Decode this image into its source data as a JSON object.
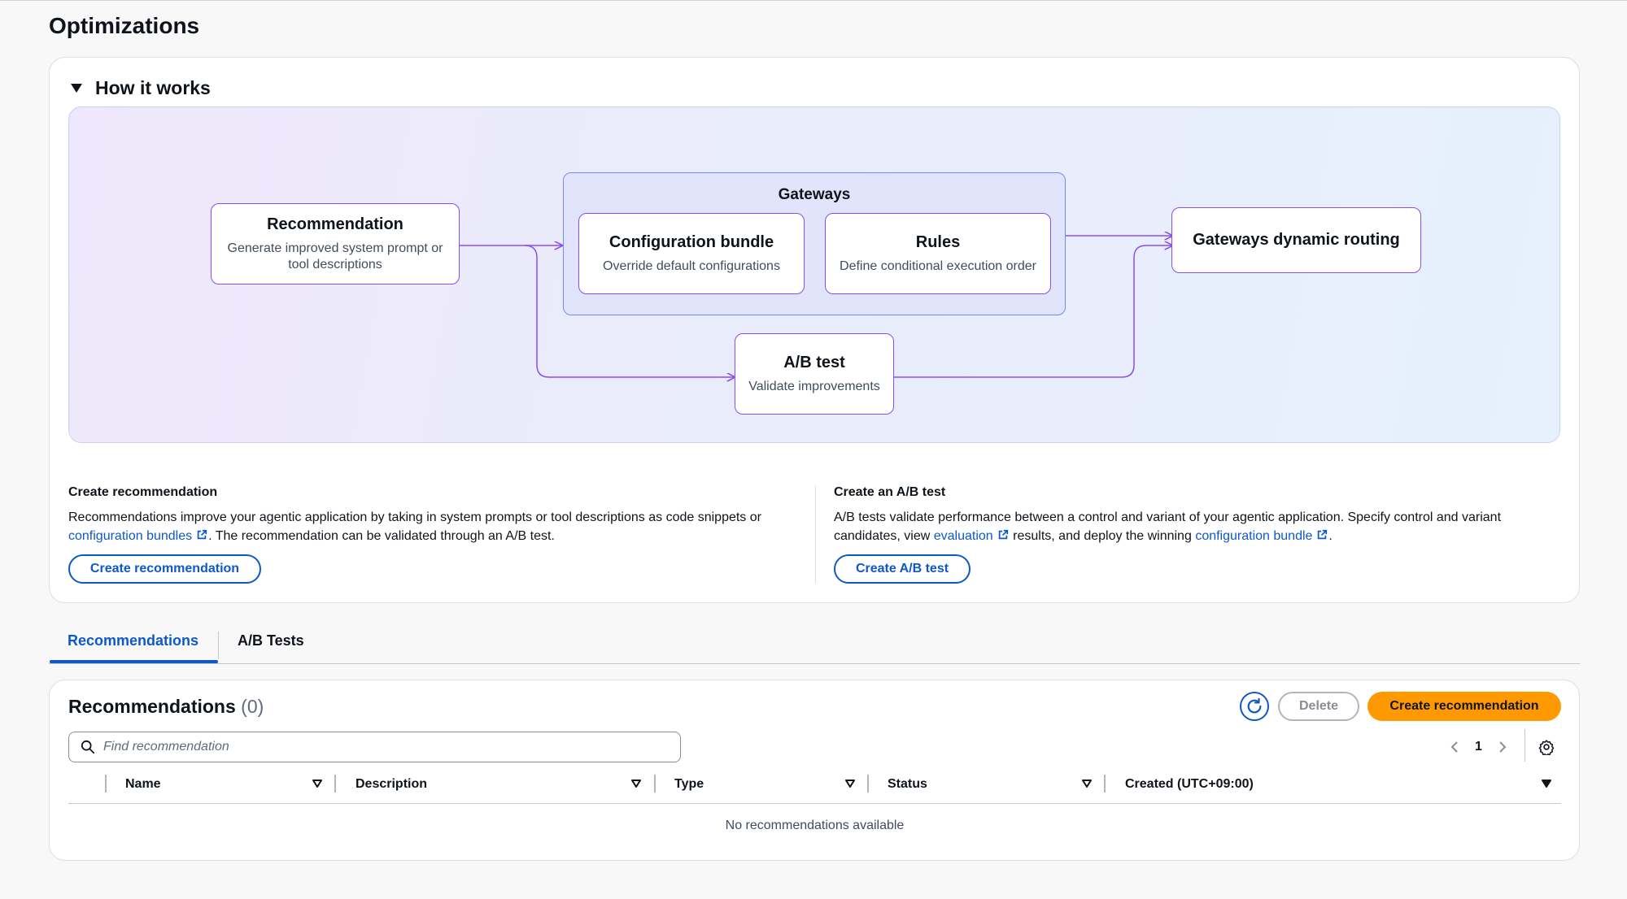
{
  "page": {
    "title": "Optimizations"
  },
  "how_it_works": {
    "title": "How it works",
    "diagram": {
      "recommendation": {
        "title": "Recommendation",
        "subtitle_line1": "Generate improved system prompt or",
        "subtitle_line2": "tool descriptions"
      },
      "gateways": {
        "title": "Gateways"
      },
      "config_bundle": {
        "title": "Configuration bundle",
        "subtitle": "Override default configurations"
      },
      "rules": {
        "title": "Rules",
        "subtitle": "Define conditional execution order"
      },
      "routing": {
        "title": "Gateways dynamic routing"
      },
      "ab_test": {
        "title": "A/B test",
        "subtitle": "Validate improvements"
      }
    },
    "create_recommendation": {
      "title": "Create recommendation",
      "text1": "Recommendations improve your agentic application by taking in system prompts or tool descriptions as code snippets or",
      "link1": "configuration bundles",
      "text2": ". The recommendation can be validated through an A/B test.",
      "button": "Create recommendation"
    },
    "create_ab_test": {
      "title": "Create an A/B test",
      "text1": "A/B tests validate performance between a control and variant of your agentic application. Specify control and variant",
      "text2": "candidates, view",
      "link1": "evaluation",
      "text3": "results, and deploy the winning",
      "link2": "configuration bundle",
      "text4": ".",
      "button": "Create A/B test"
    }
  },
  "tabs": [
    {
      "label": "Recommendations",
      "active": true
    },
    {
      "label": "A/B Tests",
      "active": false
    }
  ],
  "recommendations": {
    "title": "Recommendations",
    "count": "(0)",
    "delete_label": "Delete",
    "create_label": "Create recommendation",
    "search_placeholder": "Find recommendation",
    "page_number": "1",
    "columns": [
      "Name",
      "Description",
      "Type",
      "Status",
      "Created (UTC+09:00)"
    ],
    "empty_text": "No recommendations available"
  },
  "colors": {
    "accent": "#0f58c8",
    "primary_button": "#ff9900",
    "diagram_stroke": "#8a4df0"
  },
  "icons": [
    "caret-down-icon",
    "external-link-icon",
    "refresh-icon",
    "search-icon",
    "chevron-left-icon",
    "chevron-right-icon",
    "settings-icon",
    "sort-icon"
  ]
}
